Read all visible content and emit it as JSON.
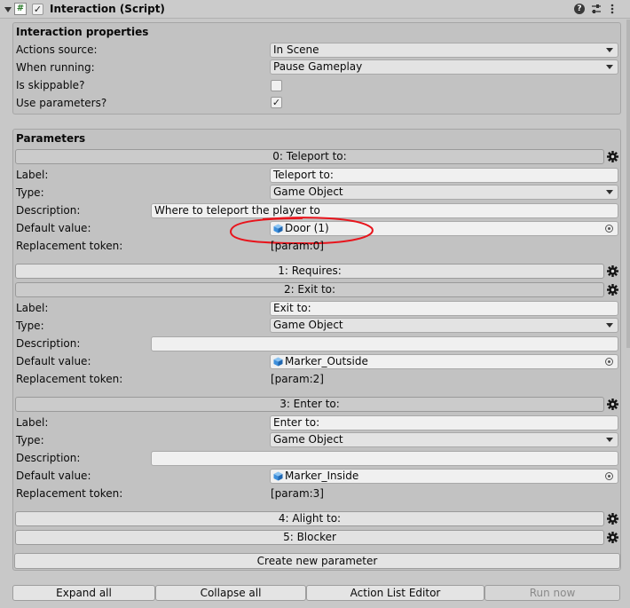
{
  "header": {
    "component_title": "Interaction (Script)",
    "component_icon": "hash-icon",
    "icons": [
      "help-icon",
      "preset-icon",
      "more-vert-icon"
    ]
  },
  "interaction_properties": {
    "section_title": "Interaction properties",
    "actions_source_label": "Actions source:",
    "actions_source_value": "In Scene",
    "when_running_label": "When running:",
    "when_running_value": "Pause Gameplay",
    "is_skippable_label": "Is skippable?",
    "is_skippable_checked": false,
    "use_parameters_label": "Use parameters?",
    "use_parameters_checked": true
  },
  "parameters": {
    "section_title": "Parameters",
    "field_labels": {
      "label": "Label:",
      "type": "Type:",
      "description": "Description:",
      "default_value": "Default value:",
      "replacement_token": "Replacement token:"
    },
    "items": [
      {
        "header": "0: Teleport to:",
        "expanded": true,
        "label": "Teleport to:",
        "type": "Game Object",
        "description": "Where to teleport the player to",
        "default_value": "Door (1)",
        "replacement_token": "[param:0]"
      },
      {
        "header": "1: Requires:",
        "expanded": false
      },
      {
        "header": "2: Exit to:",
        "expanded": true,
        "label": "Exit to:",
        "type": "Game Object",
        "description": "",
        "default_value": "Marker_Outside",
        "replacement_token": "[param:2]"
      },
      {
        "header": "3: Enter to:",
        "expanded": true,
        "label": "Enter to:",
        "type": "Game Object",
        "description": "",
        "default_value": "Marker_Inside",
        "replacement_token": "[param:3]"
      },
      {
        "header": "4: Alight to:",
        "expanded": false
      },
      {
        "header": "5: Blocker",
        "expanded": false
      }
    ],
    "create_button": "Create new parameter"
  },
  "footer": {
    "expand_all": "Expand all",
    "collapse_all": "Collapse all",
    "action_list_editor": "Action List Editor",
    "run_now": "Run now"
  },
  "colors": {
    "annotation": "#e8141c",
    "object_icon": "#3d8fdc",
    "panel_bg": "#c2c2c2",
    "page_bg": "#c8c8c8"
  }
}
